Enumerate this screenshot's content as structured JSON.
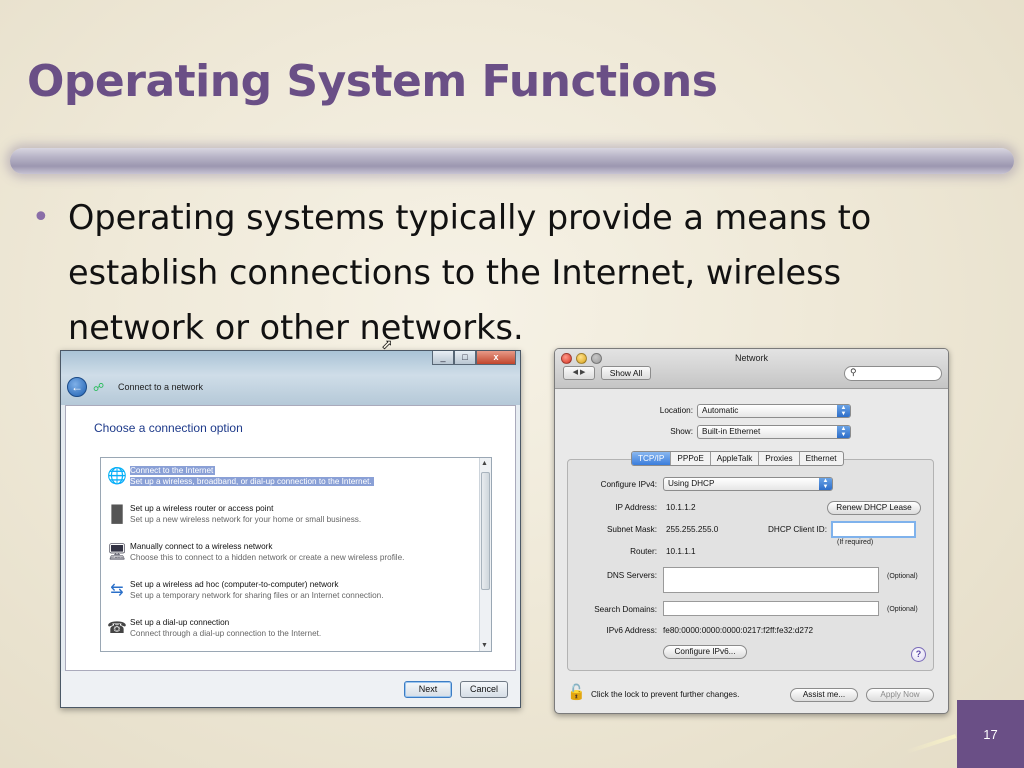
{
  "slide": {
    "title": "Operating System Functions",
    "bullet": "Operating systems typically provide a means to establish connections to the Internet, wireless network or other networks.",
    "page_number": "17",
    "accent_color": "#6a4f86"
  },
  "windows_dialog": {
    "title": "Connect to a network",
    "heading": "Choose a connection option",
    "window_controls": [
      "_",
      "□",
      "x"
    ],
    "options": [
      {
        "title": "Connect to the Internet",
        "desc": "Set up a wireless, broadband, or dial-up connection to the Internet.",
        "icon": "globe-icon",
        "selected": true
      },
      {
        "title": "Set up a wireless router or access point",
        "desc": "Set up a new wireless network for your home or small business.",
        "icon": "router-icon",
        "selected": false
      },
      {
        "title": "Manually connect to a wireless network",
        "desc": "Choose this to connect to a hidden network or create a new wireless profile.",
        "icon": "wireless-computer-icon",
        "selected": false
      },
      {
        "title": "Set up a wireless ad hoc (computer-to-computer) network",
        "desc": "Set up a temporary network for sharing files or an Internet connection.",
        "icon": "adhoc-network-icon",
        "selected": false
      },
      {
        "title": "Set up a dial-up connection",
        "desc": "Connect through a dial-up connection to the Internet.",
        "icon": "dialup-icon",
        "selected": false
      }
    ],
    "next_label": "Next",
    "cancel_label": "Cancel"
  },
  "mac_network": {
    "window_title": "Network",
    "show_all": "Show All",
    "location_label": "Location:",
    "location_value": "Automatic",
    "show_label": "Show:",
    "show_value": "Built-in Ethernet",
    "tabs": [
      "TCP/IP",
      "PPPoE",
      "AppleTalk",
      "Proxies",
      "Ethernet"
    ],
    "active_tab": "TCP/IP",
    "configure_label": "Configure IPv4:",
    "configure_value": "Using DHCP",
    "ip_label": "IP Address:",
    "ip_value": "10.1.1.2",
    "renew_button": "Renew DHCP Lease",
    "subnet_label": "Subnet Mask:",
    "subnet_value": "255.255.255.0",
    "client_id_label": "DHCP Client ID:",
    "if_required": "(If required)",
    "router_label": "Router:",
    "router_value": "10.1.1.1",
    "dns_label": "DNS Servers:",
    "search_domains_label": "Search Domains:",
    "optional": "(Optional)",
    "ipv6_label": "IPv6 Address:",
    "ipv6_value": "fe80:0000:0000:0000:0217:f2ff:fe32:d272",
    "configure_ipv6_button": "Configure IPv6...",
    "help": "?",
    "lock_text": "Click the lock to prevent further changes.",
    "assist_button": "Assist me...",
    "apply_button": "Apply Now"
  }
}
